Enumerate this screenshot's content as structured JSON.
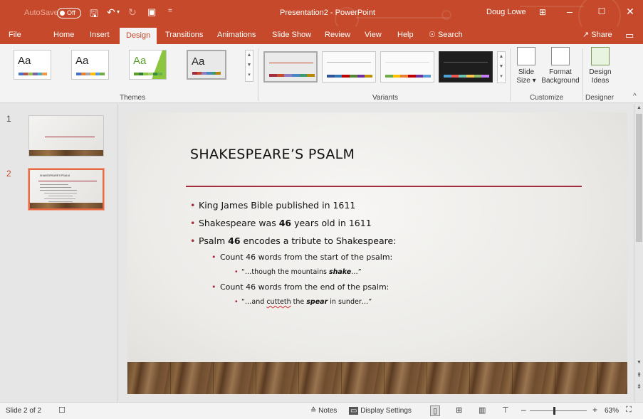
{
  "titlebar": {
    "autosave_label": "AutoSave",
    "autosave_state": "Off",
    "title": "Presentation2 - PowerPoint",
    "user": "Doug Lowe",
    "accent": "#c5492a"
  },
  "tabs": [
    "File",
    "Home",
    "Insert",
    "Design",
    "Transitions",
    "Animations",
    "Slide Show",
    "Review",
    "View",
    "Help"
  ],
  "active_tab": "Design",
  "search_label": "Search",
  "share_label": "Share",
  "ribbon": {
    "themes_label": "Themes",
    "theme_sample": "Aa",
    "variants_label": "Variants",
    "customize_label": "Customize",
    "designer_label": "Designer",
    "slide_size": {
      "line1": "Slide",
      "line2": "Size"
    },
    "format_background": {
      "line1": "Format",
      "line2": "Background"
    },
    "design_ideas": {
      "line1": "Design",
      "line2": "Ideas"
    }
  },
  "slides_pane": {
    "numbers": [
      "1",
      "2"
    ],
    "thumb_title": "SHAKESPEARE'S PSALM"
  },
  "slide": {
    "title": "SHAKESPEARE’S PSALM",
    "b1": "King James Bible published in 1611",
    "b2_pre": "Shakespeare was ",
    "b2_num": "46",
    "b2_post": " years old in 1611",
    "b3_pre": "Psalm ",
    "b3_num": "46",
    "b3_post": " encodes a tribute to Shakespeare:",
    "s1": "Count 46 words from the start of the psalm:",
    "q1_pre": "“…though the mountains ",
    "q1_em": "shake",
    "q1_post": "…”",
    "s2": "Count 46 words from the end of the psalm:",
    "q2_pre": "“…and ",
    "q2_sq": "cutteth",
    "q2_mid": " the ",
    "q2_em": "spear",
    "q2_post": " in sunder…”"
  },
  "status": {
    "slide_info": "Slide 2 of 2",
    "notes": "Notes",
    "display_settings": "Display Settings",
    "zoom": "63%",
    "zoom_fraction": 0.42
  }
}
